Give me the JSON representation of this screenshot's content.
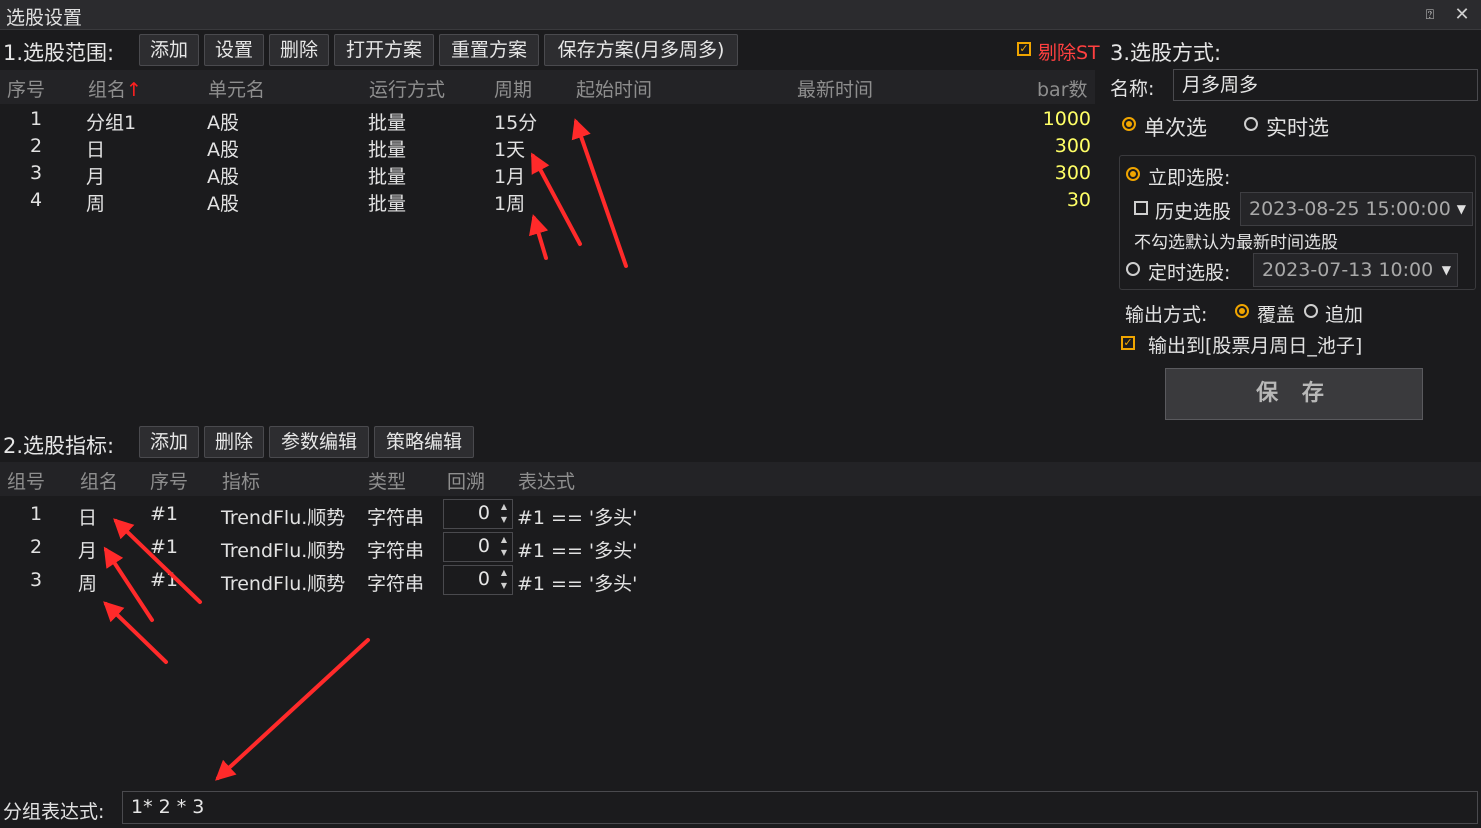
{
  "window": {
    "title": "选股设置",
    "help_icon": "help-circle-icon",
    "close_icon": "close-icon"
  },
  "scope": {
    "label": "1.选股范围:",
    "buttons": [
      "添加",
      "设置",
      "删除",
      "打开方案",
      "重置方案",
      "保存方案(月多周多)"
    ],
    "exclude_st": {
      "label": "剔除ST",
      "checked": true
    },
    "headers": [
      "序号",
      "组名",
      "单元名",
      "运行方式",
      "周期",
      "起始时间",
      "最新时间",
      "bar数"
    ],
    "sort_indicator": "↑",
    "rows": [
      {
        "idx": "1",
        "group": "分组1",
        "unit": "A股",
        "mode": "批量",
        "period": "15分",
        "start": "",
        "latest": "",
        "bars": "1000"
      },
      {
        "idx": "2",
        "group": "日",
        "unit": "A股",
        "mode": "批量",
        "period": "1天",
        "start": "",
        "latest": "",
        "bars": "300"
      },
      {
        "idx": "3",
        "group": "月",
        "unit": "A股",
        "mode": "批量",
        "period": "1月",
        "start": "",
        "latest": "",
        "bars": "300"
      },
      {
        "idx": "4",
        "group": "周",
        "unit": "A股",
        "mode": "批量",
        "period": "1周",
        "start": "",
        "latest": "",
        "bars": "30"
      }
    ]
  },
  "indicators": {
    "label": "2.选股指标:",
    "buttons": [
      "添加",
      "删除",
      "参数编辑",
      "策略编辑"
    ],
    "headers": [
      "组号",
      "组名",
      "序号",
      "指标",
      "类型",
      "回溯",
      "表达式"
    ],
    "rows": [
      {
        "group_no": "1",
        "group": "日",
        "seq": "#1",
        "indicator": "TrendFlu.顺势",
        "type": "字符串",
        "lookback": "0",
        "expr": "#1 == '多头'"
      },
      {
        "group_no": "2",
        "group": "月",
        "seq": "#1",
        "indicator": "TrendFlu.顺势",
        "type": "字符串",
        "lookback": "0",
        "expr": "#1 == '多头'"
      },
      {
        "group_no": "3",
        "group": "周",
        "seq": "#1",
        "indicator": "TrendFlu.顺势",
        "type": "字符串",
        "lookback": "0",
        "expr": "#1 == '多头'"
      }
    ]
  },
  "group_expr": {
    "label": "分组表达式:",
    "value": "1* 2 * 3"
  },
  "method": {
    "label": "3.选股方式:",
    "name_label": "名称:",
    "name_value": "月多周多",
    "single_label": "单次选",
    "realtime_label": "实时选",
    "selected": "single",
    "immediate_label": "立即选股:",
    "history_label": "历史选股",
    "history_checked": false,
    "history_datetime": "2023-08-25 15:00:00",
    "default_note": "不勾选默认为最新时间选股",
    "timed_label": "定时选股:",
    "timed_datetime": "2023-07-13 10:00",
    "output_label": "输出方式:",
    "overwrite_label": "覆盖",
    "append_label": "追加",
    "output_selected": "overwrite",
    "output_to_label": "输出到[股票月周日_池子]",
    "output_to_checked": true,
    "save_label": "保 存"
  },
  "colors": {
    "accent": "#f0a500",
    "bar_count": "#ffff66",
    "exclude_st": "#ff4040",
    "sort_arrow": "#ff2020",
    "annotation_arrow": "#ff2a2a"
  }
}
